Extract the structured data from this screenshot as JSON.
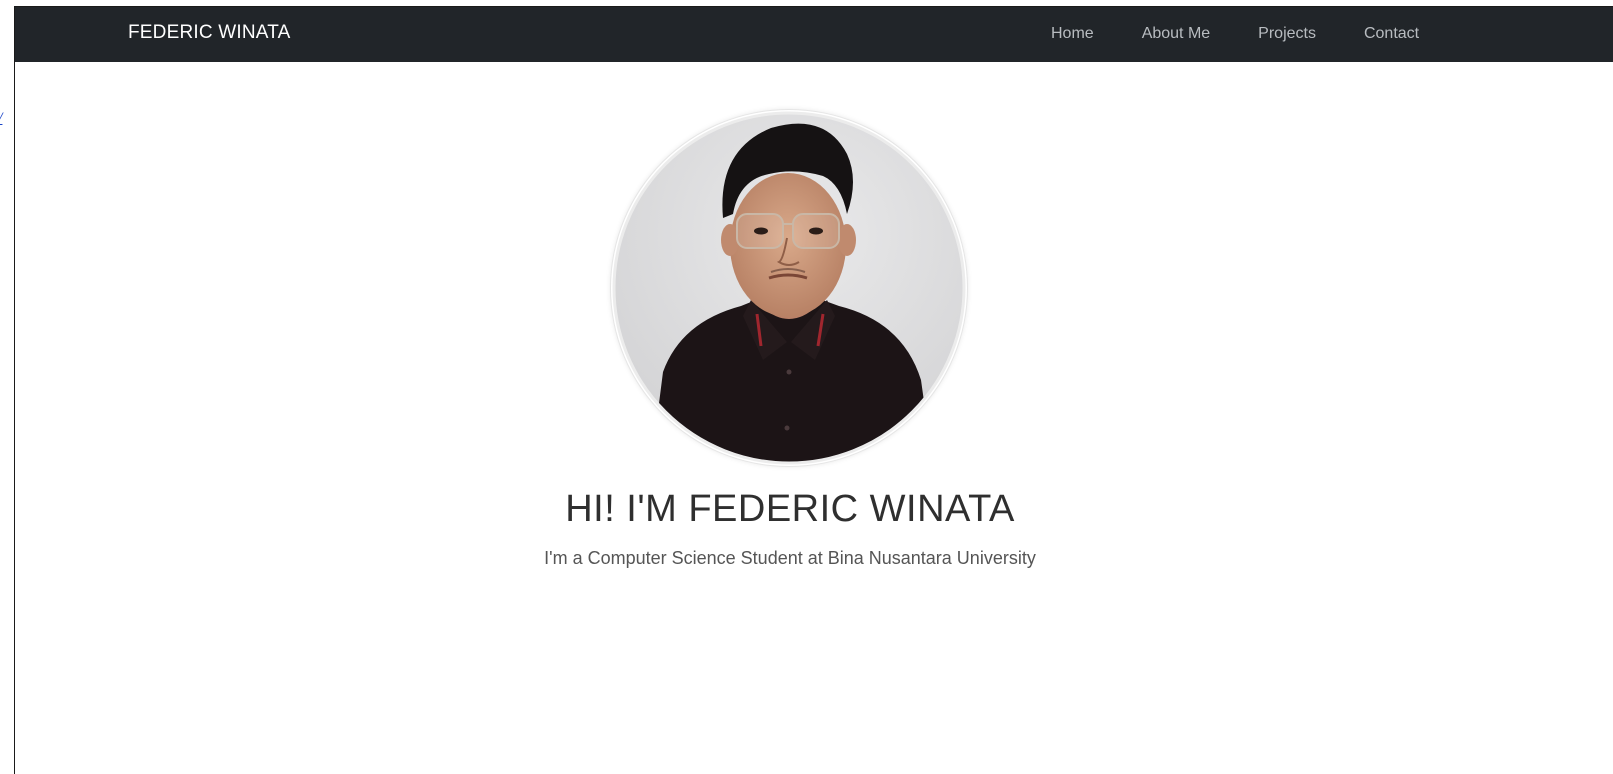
{
  "navbar": {
    "brand": "FEDERIC WINATA",
    "links": [
      {
        "label": "Home"
      },
      {
        "label": "About Me"
      },
      {
        "label": "Projects"
      },
      {
        "label": "Contact"
      }
    ]
  },
  "hero": {
    "headline": "HI! I'M FEDERIC WINATA",
    "subline": "I'm a Computer Science Student at Bina Nusantara University"
  },
  "colors": {
    "navbar_bg": "#212529",
    "brand_text": "#ffffff",
    "nav_link_text": "#b8bcc0",
    "headline_text": "#2f2f2f",
    "subline_text": "#555555"
  },
  "icons": {
    "avatar": "profile-photo"
  }
}
